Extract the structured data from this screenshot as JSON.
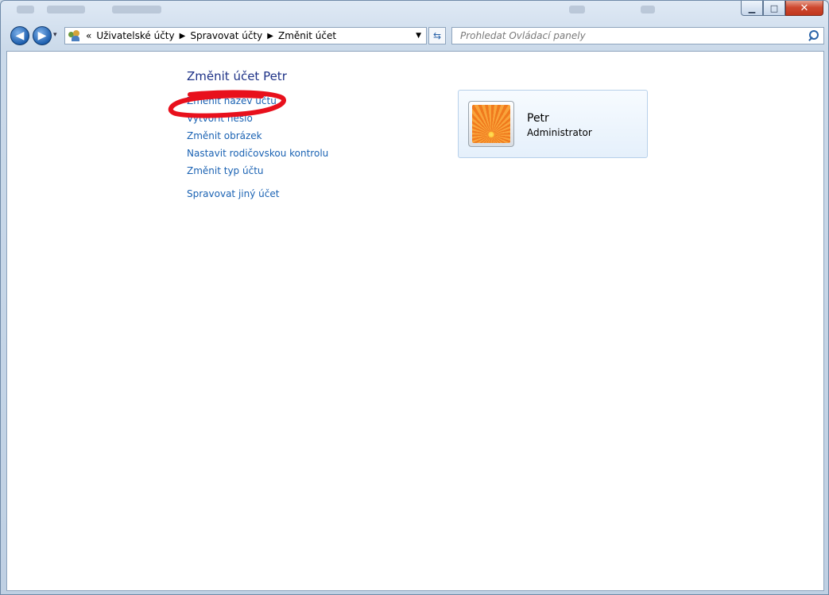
{
  "window": {
    "minimize_glyph": "▁",
    "maximize_glyph": "□",
    "close_glyph": "✕"
  },
  "toolbar": {
    "back_glyph": "◀",
    "forward_glyph": "▶",
    "history_dropdown_glyph": "▾",
    "breadcrumb_overflow": "«",
    "breadcrumbs": [
      "Uživatelské účty",
      "Spravovat účty",
      "Změnit účet"
    ],
    "separator_glyph": "▶",
    "address_dropdown_glyph": "▼",
    "refresh_glyph": "⇆",
    "search_placeholder": "Prohledat Ovládací panely"
  },
  "page": {
    "heading": "Změnit účet Petr",
    "tasks": [
      "Změnit název účtu",
      "Vytvořit heslo",
      "Změnit obrázek",
      "Nastavit rodičovskou kontrolu",
      "Změnit typ účtu"
    ],
    "other_task": "Spravovat jiný účet"
  },
  "account": {
    "name": "Petr",
    "role": "Administrator"
  },
  "colors": {
    "link": "#1a62b3",
    "heading": "#1e3287",
    "annotation": "#e8101c"
  },
  "icons": {
    "address": "users-icon",
    "search": "search-icon"
  }
}
